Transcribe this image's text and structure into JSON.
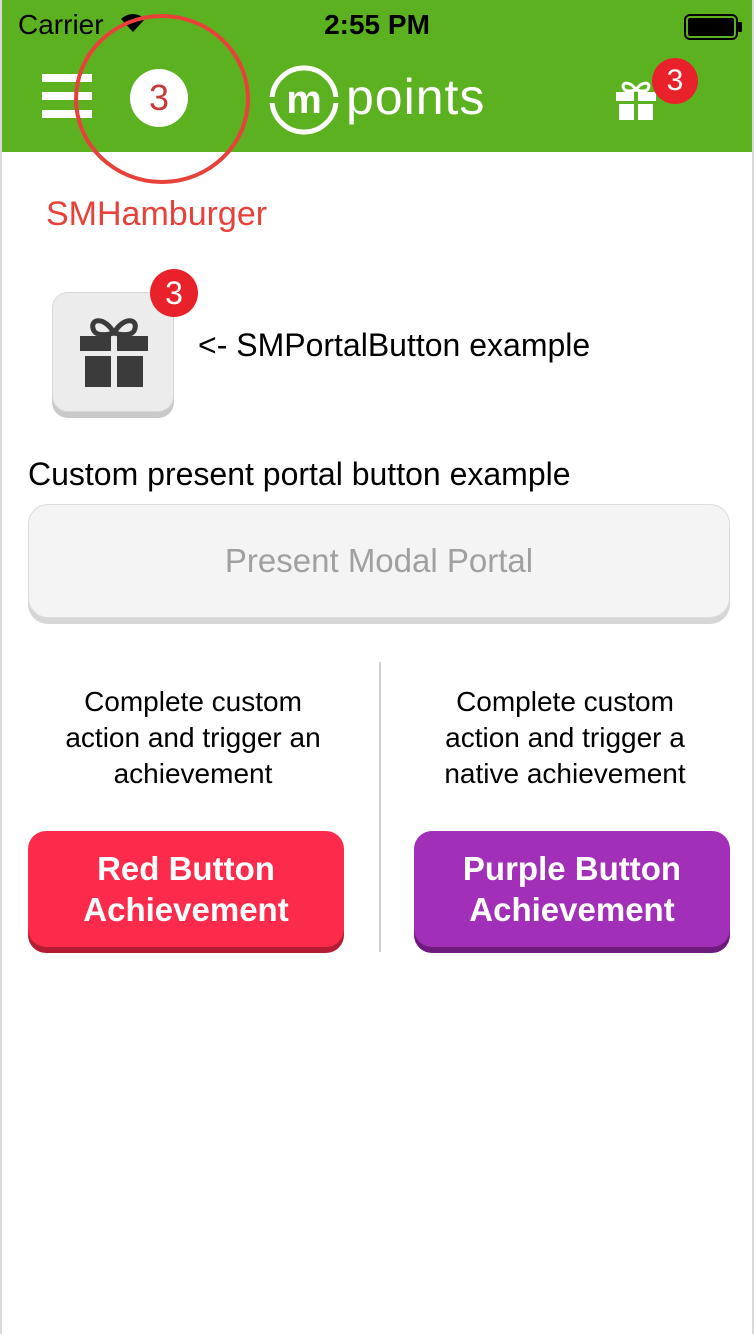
{
  "status_bar": {
    "carrier": "Carrier",
    "time": "2:55 PM",
    "wifi_icon": "wifi-icon",
    "battery_icon": "battery-icon"
  },
  "nav_bar": {
    "background_color": "#5cb120",
    "menu_icon": "hamburger-icon",
    "menu_badge_count": "3",
    "logo_letter": "m",
    "logo_text": "points",
    "gift_icon": "gift-icon",
    "gift_badge_count": "3"
  },
  "annotation": {
    "label": "SMHamburger",
    "color": "#e8413a"
  },
  "portal_example": {
    "icon": "gift-icon",
    "badge_count": "3",
    "caption": "<- SMPortalButton example"
  },
  "custom_portal": {
    "heading": "Custom present portal button example",
    "button_label": "Present Modal Portal"
  },
  "achievements": {
    "left": {
      "description_lines": [
        "Complete custom",
        "action and trigger an",
        "achievement"
      ],
      "button_lines": [
        "Red Button",
        "Achievement"
      ],
      "color": "#fd2b4b"
    },
    "right": {
      "description_lines": [
        "Complete custom",
        "action and trigger a",
        "native achievement"
      ],
      "button_lines": [
        "Purple Button",
        "Achievement"
      ],
      "color": "#a22fb7"
    }
  }
}
